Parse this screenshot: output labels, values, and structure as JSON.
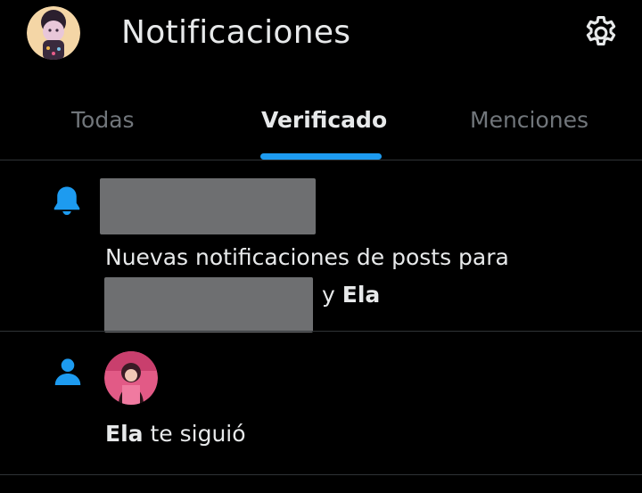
{
  "header": {
    "title": "Notificaciones",
    "avatar_label": "",
    "settings_icon": "gear-icon"
  },
  "tabs": [
    {
      "label": "Todas",
      "active": false
    },
    {
      "label": "Verificado",
      "active": true
    },
    {
      "label": "Menciones",
      "active": false
    }
  ],
  "notifications": [
    {
      "icon": "bell-icon",
      "text_line1": "Nuevas notificaciones de posts para",
      "text_connector": "y",
      "text_name": "Ela"
    },
    {
      "icon": "person-icon",
      "name": "Ela",
      "action": "te siguió"
    }
  ],
  "colors": {
    "accent": "#1d9bf0",
    "background": "#000000",
    "text": "#e7e9ea",
    "muted": "#71767b",
    "divider": "#2f3336"
  }
}
